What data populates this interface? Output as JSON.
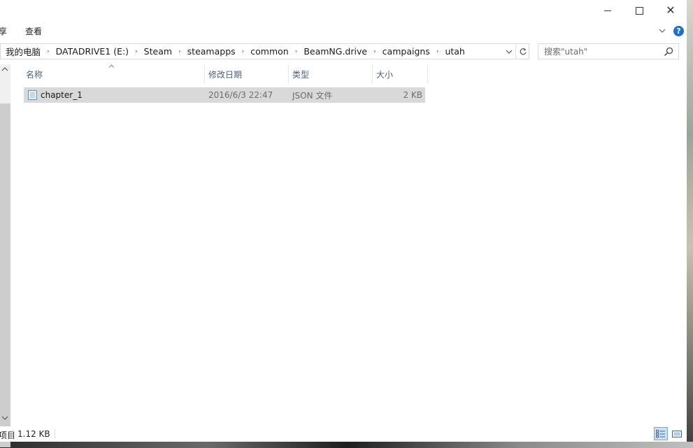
{
  "window": {
    "minimize_glyph": "",
    "close_glyph": "✕"
  },
  "ribbon": {
    "tabs": [
      {
        "label": "享"
      },
      {
        "label": "查看"
      }
    ],
    "help_glyph": "?"
  },
  "address": {
    "crumbs": [
      "我的电脑",
      "DATADRIVE1 (E:)",
      "Steam",
      "steamapps",
      "common",
      "BeamNG.drive",
      "campaigns",
      "utah"
    ],
    "separator": "›"
  },
  "search": {
    "placeholder": "搜索\"utah\""
  },
  "columns": {
    "name": "名称",
    "date": "修改日期",
    "type": "类型",
    "size": "大小"
  },
  "files": [
    {
      "name": "chapter_1",
      "date": "2016/6/3 22:47",
      "type": "JSON 文件",
      "size": "2 KB",
      "selected": true
    }
  ],
  "status": {
    "items": "项目",
    "selected_size": "1.12 KB"
  },
  "colors": {
    "accent": "#1e6fd0",
    "selection": "#d9d9d9",
    "header_text": "#4c607a"
  }
}
